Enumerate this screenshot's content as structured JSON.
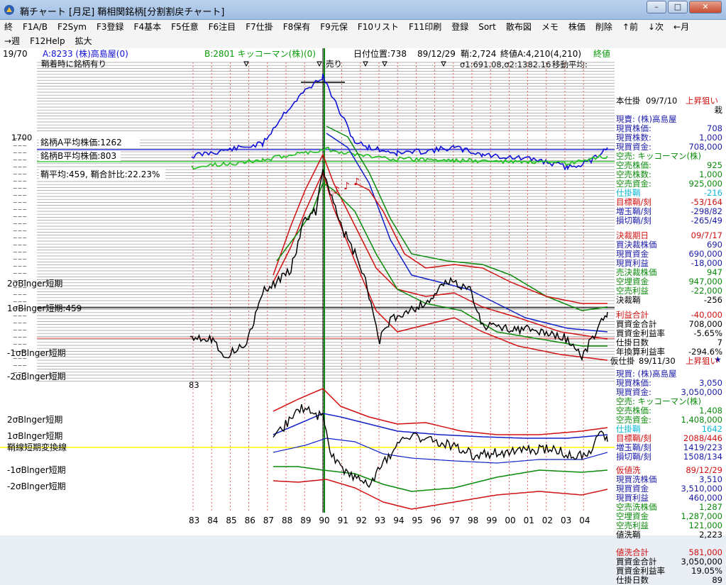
{
  "window": {
    "title": "鞘チャート [月足] 鞘相関銘柄[分割割戻チャート]",
    "buttons": {
      "minimize": "–",
      "maximize": "□",
      "close": "✕"
    }
  },
  "menu": {
    "row1": [
      "終",
      "F1A/B",
      "F2Sym",
      "F3登録",
      "F4基本",
      "F5任意",
      "F6注目",
      "F7仕掛",
      "F8保有",
      "F9元保",
      "F10リスト",
      "F11印刷",
      "登録",
      "Sort",
      "散布図",
      "メモ",
      "株価",
      "削除",
      "↑前",
      "↓次",
      "←月"
    ],
    "row2": [
      "→週",
      "F12Help",
      "拡大"
    ]
  },
  "header": {
    "counter": "19/70",
    "symbol_a": "A:8233 (株)高島屋(0)",
    "symbol_b": "B:2801 キッコーマン(株)(0)",
    "date_pos": "日付位置:738",
    "date": "89/12/29",
    "spread": "鞘:2,724",
    "close_a": "終値A:4,210(4,210)",
    "close_b_partial": "終値",
    "sigma": "σ1:691.08,σ2:1382.16",
    "moving_avg": "移動平均:"
  },
  "upper": {
    "note": "鞘着時に銘柄有り",
    "sell_marker": "売り",
    "avg_a": "銘柄A平均株価:1262",
    "avg_b": "銘柄B平均株価:803",
    "spread_avg": "鞘平均:459, 鞘合計比:22.23%",
    "left_1700": "1700",
    "x_start_label": "83",
    "bands": {
      "p2": "2σBlnger短期",
      "p1": "1σBlnger短期:459",
      "m1": "-1σBlnger短期",
      "m2": "-2σBlnger短期"
    }
  },
  "lower": {
    "bands": {
      "p2": "2σBlnger短期",
      "p1": "1σBlnger短期",
      "conv": "鞘線短期変換線",
      "m1": "-1σBlnger短期",
      "m2": "-2σBlnger短期"
    }
  },
  "x_axis": [
    "83",
    "84",
    "85",
    "86",
    "87",
    "88",
    "89",
    "90",
    "91",
    "92",
    "93",
    "94",
    "95",
    "96",
    "97",
    "98",
    "99",
    "00",
    "01",
    "02",
    "03",
    "04"
  ],
  "right_panel": {
    "head_label": "本仕掛",
    "head_date": "09/7/10",
    "head_status": "上昇狙い",
    "head_trunc": "栽",
    "rows1": [
      {
        "k": "現賣: (株)高島屋",
        "v": "",
        "c": "#1a1aa8"
      },
      {
        "k": "現買株価:",
        "v": "708",
        "c": "#1a1aa8"
      },
      {
        "k": "現買株数:",
        "v": "1,000",
        "c": "#1a1aa8"
      },
      {
        "k": "現買資金:",
        "v": "708,000",
        "c": "#1a1aa8"
      },
      {
        "k": "空売: キッコーマン(株)",
        "v": "",
        "c": "#0a8a0a"
      },
      {
        "k": "空売株価:",
        "v": "925",
        "c": "#0a8a0a"
      },
      {
        "k": "空売株数:",
        "v": "1,000",
        "c": "#0a8a0a"
      },
      {
        "k": "空売資金:",
        "v": "925,000",
        "c": "#0a8a0a"
      },
      {
        "k": "仕掛鞘",
        "v": "-216",
        "c": "#10b8d8"
      },
      {
        "k": "目標鞘/刻",
        "v": "-53/164",
        "c": "#d01010"
      },
      {
        "k": "増玉鞘/刻",
        "v": "-298/82",
        "c": "#1a1aa8"
      },
      {
        "k": "損切鞘/刻",
        "v": "-265/49",
        "c": "#1a1aa8"
      }
    ],
    "rows2": [
      {
        "k": "決裁期日",
        "v": "09/7/17",
        "c": "#d01010"
      },
      {
        "k": "買決裁株価",
        "v": "690",
        "c": "#1a1aa8"
      },
      {
        "k": "現買資金",
        "v": "690,000",
        "c": "#1a1aa8"
      },
      {
        "k": "現買利益",
        "v": "-18,000",
        "c": "#1a1aa8"
      },
      {
        "k": "売決裁株価",
        "v": "947",
        "c": "#0a8a0a"
      },
      {
        "k": "空埋資金",
        "v": "947,000",
        "c": "#0a8a0a"
      },
      {
        "k": "空売利益",
        "v": "-22,000",
        "c": "#0a8a0a"
      },
      {
        "k": "決裁鞘",
        "v": "-256",
        "c": "#000000"
      }
    ],
    "rows3": [
      {
        "k": "利益合計",
        "v": "-40,000",
        "c": "#d01010"
      },
      {
        "k": "買資金合計",
        "v": "708,000",
        "c": "#000000"
      },
      {
        "k": "買資金利益率",
        "v": "-5.65%",
        "c": "#000000"
      },
      {
        "k": "仕掛日数",
        "v": "7",
        "c": "#000000"
      },
      {
        "k": "年換算利益率",
        "v": "-294.6%",
        "c": "#000000"
      }
    ],
    "mid_head": {
      "label": "仮仕掛",
      "date": "89/11/30",
      "status": "上昇狙い"
    },
    "rows4": [
      {
        "k": "現買: (株)高島屋",
        "v": "",
        "c": "#1a1aa8"
      },
      {
        "k": "現買株価:",
        "v": "3,050",
        "c": "#1a1aa8"
      },
      {
        "k": "現買資金:",
        "v": "3,050,000",
        "c": "#1a1aa8"
      },
      {
        "k": "空売: キッコーマン(株)",
        "v": "",
        "c": "#0a8a0a"
      },
      {
        "k": "空売株価:",
        "v": "1,408",
        "c": "#0a8a0a"
      },
      {
        "k": "空売資金:",
        "v": "1,408,000",
        "c": "#0a8a0a"
      },
      {
        "k": "仕掛鞘",
        "v": "1642",
        "c": "#10b8d8"
      },
      {
        "k": "目標鞘/刻",
        "v": "2088/446",
        "c": "#d01010"
      },
      {
        "k": "増玉鞘/刻",
        "v": "1419/223",
        "c": "#1a1aa8"
      },
      {
        "k": "損切鞘/刻",
        "v": "1508/134",
        "c": "#1a1aa8"
      }
    ],
    "rows5": [
      {
        "k": "仮値洗",
        "v": "89/12/29",
        "c": "#d01010"
      },
      {
        "k": "現買洗株価",
        "v": "3,510",
        "c": "#1a1aa8"
      },
      {
        "k": "現買資金",
        "v": "3,510,000",
        "c": "#1a1aa8"
      },
      {
        "k": "現買利益",
        "v": "460,000",
        "c": "#1a1aa8"
      },
      {
        "k": "空売洗株価",
        "v": "1,287",
        "c": "#0a8a0a"
      },
      {
        "k": "空埋資金",
        "v": "1,287,000",
        "c": "#0a8a0a"
      },
      {
        "k": "空売利益",
        "v": "121,000",
        "c": "#0a8a0a"
      },
      {
        "k": "値洗鞘",
        "v": "2,223",
        "c": "#000000"
      }
    ],
    "rows6": [
      {
        "k": "値洗合計",
        "v": "581,000",
        "c": "#d01010"
      },
      {
        "k": "買資金合計",
        "v": "3,050,000",
        "c": "#000000"
      },
      {
        "k": "買資金利益率",
        "v": "19.05%",
        "c": "#000000"
      },
      {
        "k": "仕掛日数",
        "v": "89",
        "c": "#000000"
      }
    ]
  },
  "colors": {
    "stock_a": "#1010d8",
    "stock_b": "#20c020",
    "spread": "#000000",
    "band_2sigma": "#d01010",
    "band_1sigma": "#1020c8",
    "band_m1sigma": "#0a8a0a",
    "conversion_line": "#ffff00",
    "cursor": "#0a8a0a"
  }
}
